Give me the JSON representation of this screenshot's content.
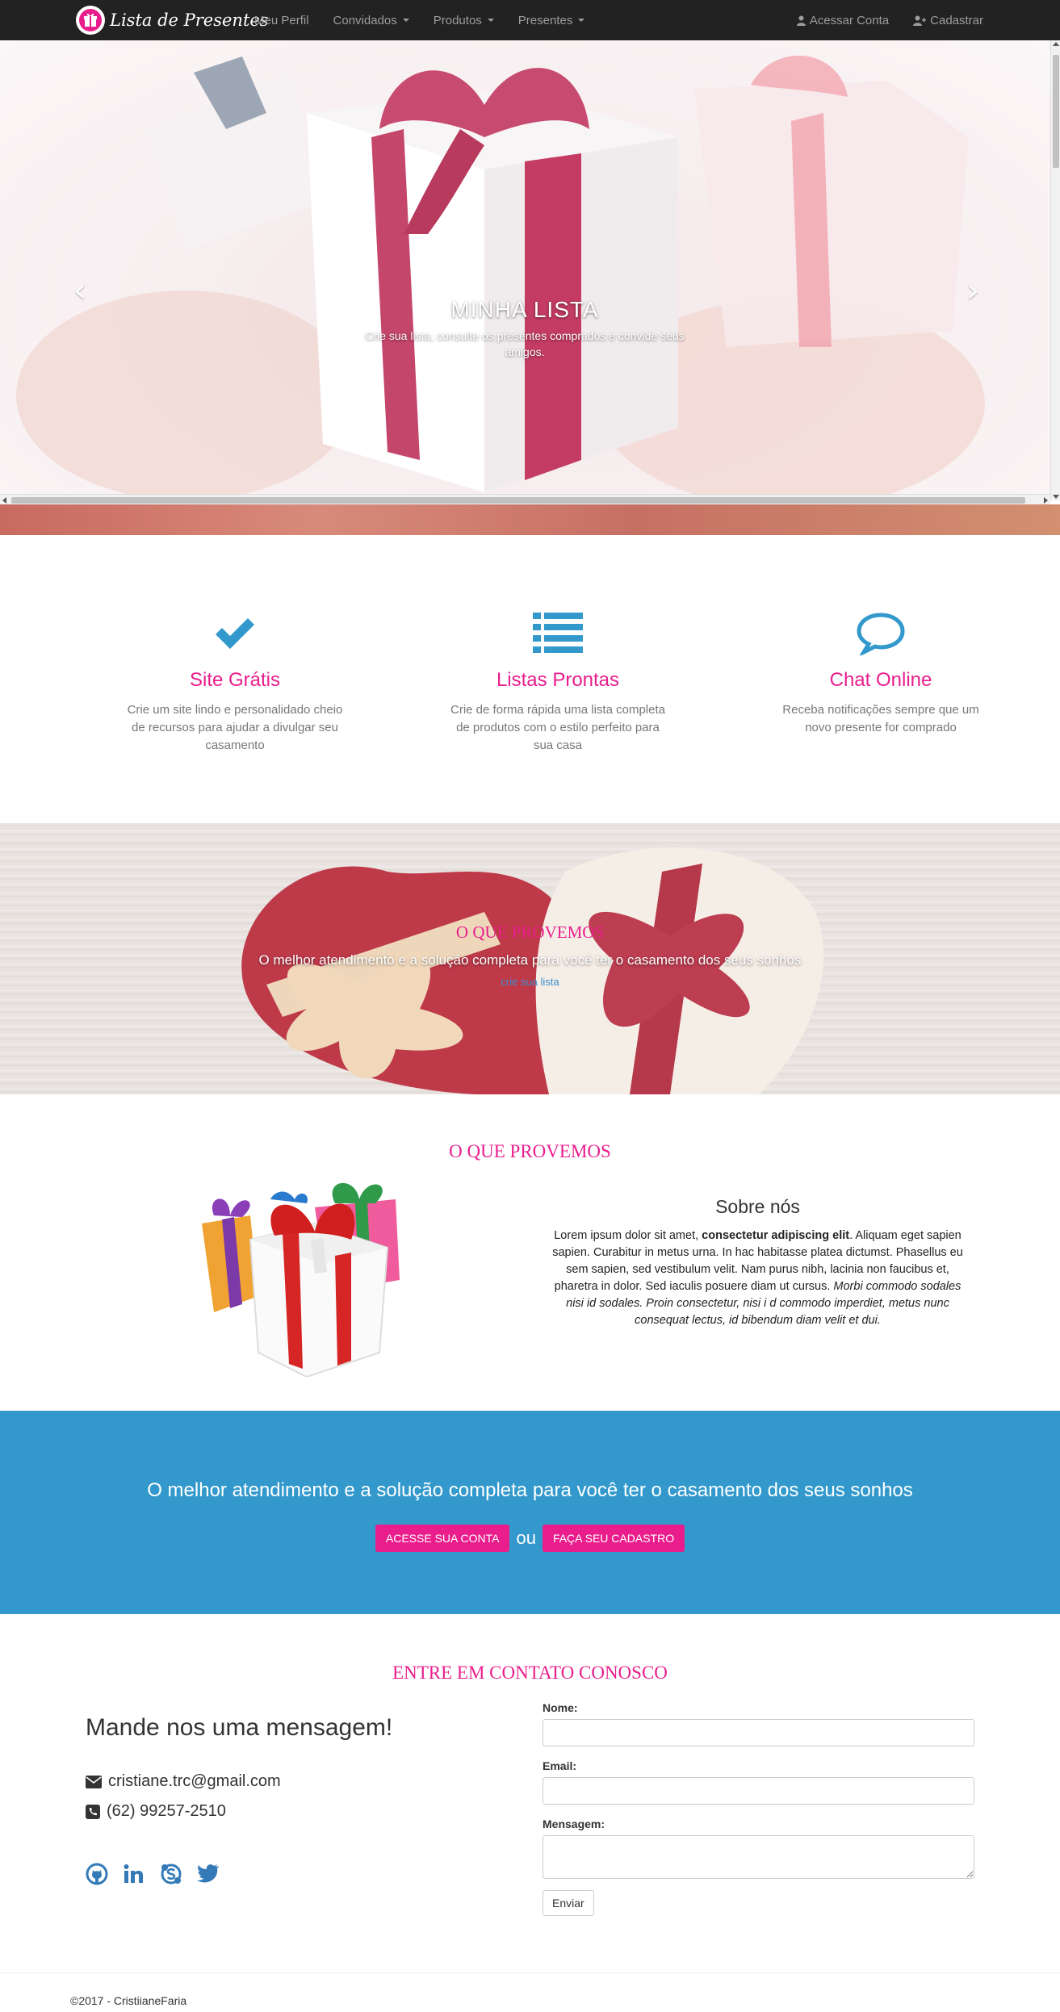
{
  "nav": {
    "brand": "Lista de Presentes",
    "items": [
      "Meu Perfil",
      "Convidados",
      "Produtos",
      "Presentes"
    ],
    "login": "Acessar Conta",
    "register": "Cadastrar"
  },
  "hero": {
    "title": "MINHA LISTA",
    "text": "Crie sua lista, consulte os presentes comprados e convide seus amigos."
  },
  "features": [
    {
      "icon": "check-icon",
      "title": "Site Grátis",
      "text": "Crie um site lindo e personalidado cheio de recursos para ajudar a divulgar seu casamento"
    },
    {
      "icon": "list-icon",
      "title": "Listas Prontas",
      "text": "Crie de forma rápida uma lista completa de produtos com o estilo perfeito para sua casa"
    },
    {
      "icon": "chat-icon",
      "title": "Chat Online",
      "text": "Receba notificações sempre que um novo presente for comprado"
    }
  ],
  "banner": {
    "title": "O QUE PROVEMOS",
    "text": "O melhor atendimento e a solução completa para você ter o casamento dos seus sonhos",
    "link": "crie sua lista"
  },
  "about": {
    "section_title": "O QUE PROVEMOS",
    "heading": "Sobre nós",
    "text_plain1": "Lorem ipsum dolor sit amet, ",
    "text_bold": "consectetur adipiscing elit",
    "text_plain2": ". Aliquam eget sapien sapien. Curabitur in metus urna. In hac habitasse platea dictumst. Phasellus eu sem sapien, sed vestibulum velit. Nam purus nibh, lacinia non faucibus et, pharetra in dolor. Sed iaculis posuere diam ut cursus. ",
    "text_italic": "Morbi commodo sodales nisi id sodales. Proin consectetur, nisi i d commodo imperdiet, metus nunc consequat lectus, id bibendum diam velit et dui."
  },
  "cta": {
    "text": "O melhor atendimento e a solução completa para você ter o casamento dos seus sonhos",
    "btn_login": "Acesse sua conta",
    "or": "ou",
    "btn_register": "Faça seu cadastro"
  },
  "contact": {
    "title": "ENTRE EM CONTATO CONOSCO",
    "heading": "Mande nos uma mensagem!",
    "email": "cristiane.trc@gmail.com",
    "phone": "(62) 99257-2510",
    "social": [
      "github-icon",
      "linkedin-icon",
      "skype-icon",
      "twitter-icon"
    ],
    "form": {
      "name_label": "Nome:",
      "email_label": "Email:",
      "message_label": "Mensagem:",
      "send": "Enviar"
    }
  },
  "footer": {
    "copyright": "©2017 - CristiianeFaria"
  },
  "colors": {
    "accent": "#e91e8c",
    "cta_bg": "#3399cc",
    "navbar": "#222222",
    "icon_blue": "#3399cc"
  }
}
